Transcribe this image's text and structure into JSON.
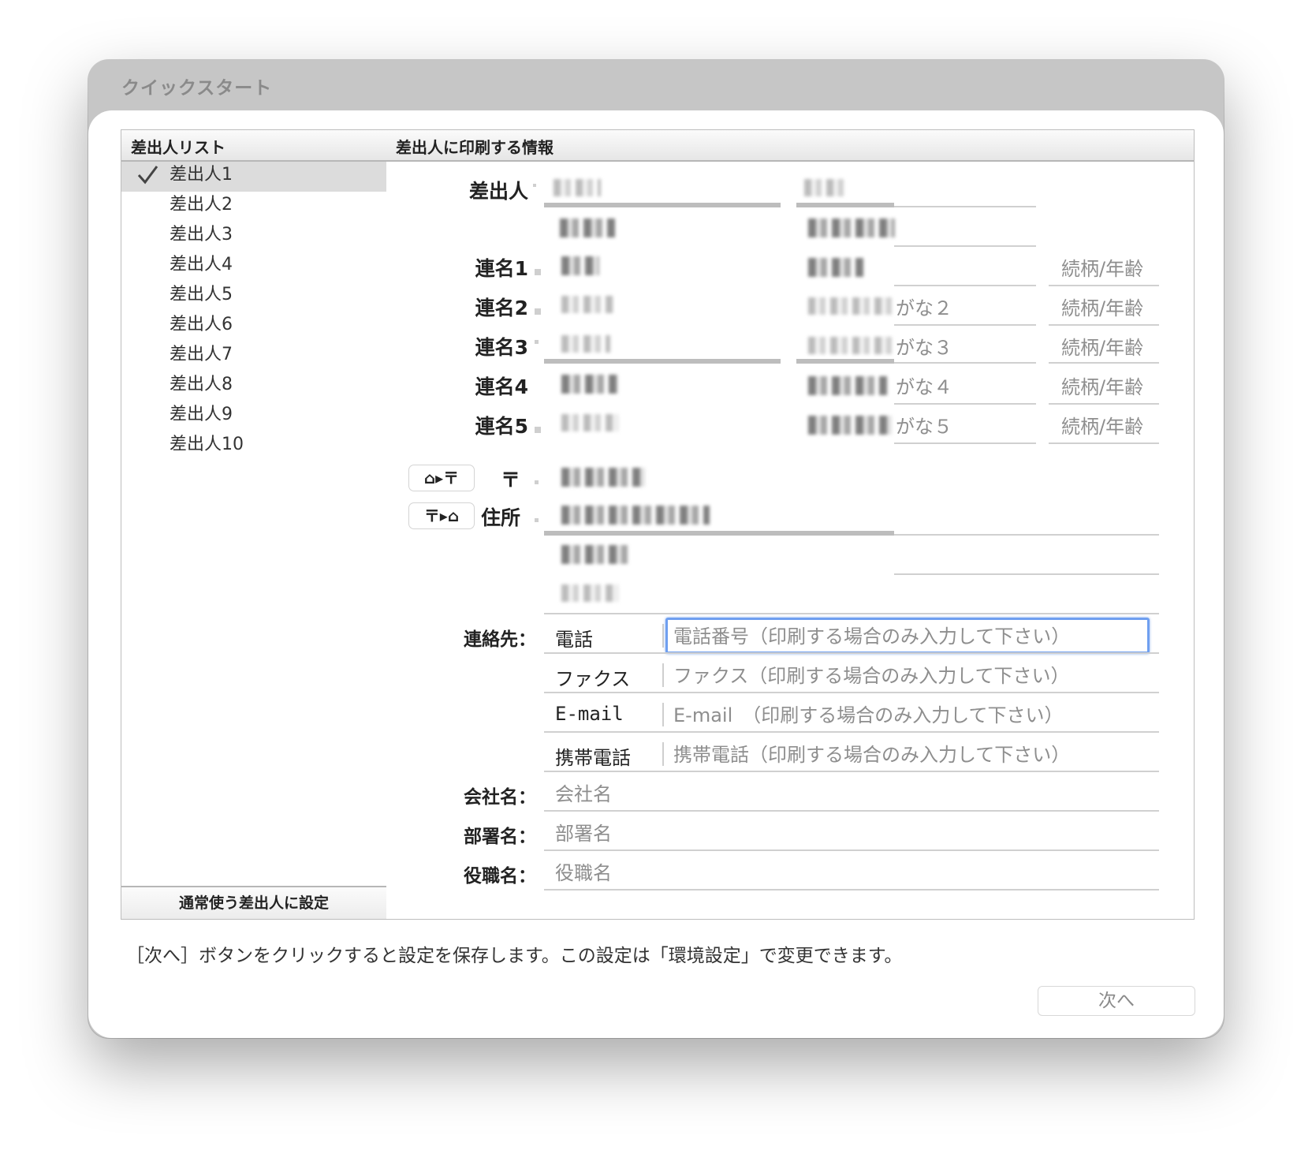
{
  "window": {
    "title": "クイックスタート"
  },
  "sender_list": {
    "header": "差出人リスト",
    "items": [
      "差出人1",
      "差出人2",
      "差出人3",
      "差出人4",
      "差出人5",
      "差出人6",
      "差出人7",
      "差出人8",
      "差出人9",
      "差出人10"
    ],
    "selected_index": 0,
    "set_default_button": "通常使う差出人に設定"
  },
  "info": {
    "header": "差出人に印刷する情報",
    "sender_label": "差出人",
    "joint_names": [
      {
        "label": "連名1",
        "furigana": "",
        "relation": "続柄/年齢"
      },
      {
        "label": "連名2",
        "furigana": "がな２",
        "relation": "続柄/年齢"
      },
      {
        "label": "連名3",
        "furigana": "がな３",
        "relation": "続柄/年齢"
      },
      {
        "label": "連名4",
        "furigana": "がな４",
        "relation": "続柄/年齢"
      },
      {
        "label": "連名5",
        "furigana": "がな５",
        "relation": "続柄/年齢"
      }
    ],
    "addr_to_zip_button": "⌂▸〒",
    "zip_to_addr_button": "〒▸⌂",
    "zip_label": "〒",
    "address_label": "住所",
    "contact_label": "連絡先：",
    "contacts": [
      {
        "label": "電話",
        "placeholder": "電話番号（印刷する場合のみ入力して下さい）"
      },
      {
        "label": "ファクス",
        "placeholder": "ファクス（印刷する場合のみ入力して下さい）"
      },
      {
        "label": "E-mail",
        "placeholder": "E-mail　（印刷する場合のみ入力して下さい）"
      },
      {
        "label": "携帯電話",
        "placeholder": "携帯電話（印刷する場合のみ入力して下さい）"
      }
    ],
    "company_label": "会社名：",
    "company_placeholder": "会社名",
    "department_label": "部署名：",
    "department_placeholder": "部署名",
    "position_label": "役職名：",
    "position_placeholder": "役職名"
  },
  "footer": {
    "note": "［次へ］ボタンをクリックすると設定を保存します。この設定は「環境設定」で変更できます。",
    "next_button": "次へ"
  },
  "colors": {
    "focus": "#6f9ff0",
    "selected_row": "#dcdcdc"
  }
}
